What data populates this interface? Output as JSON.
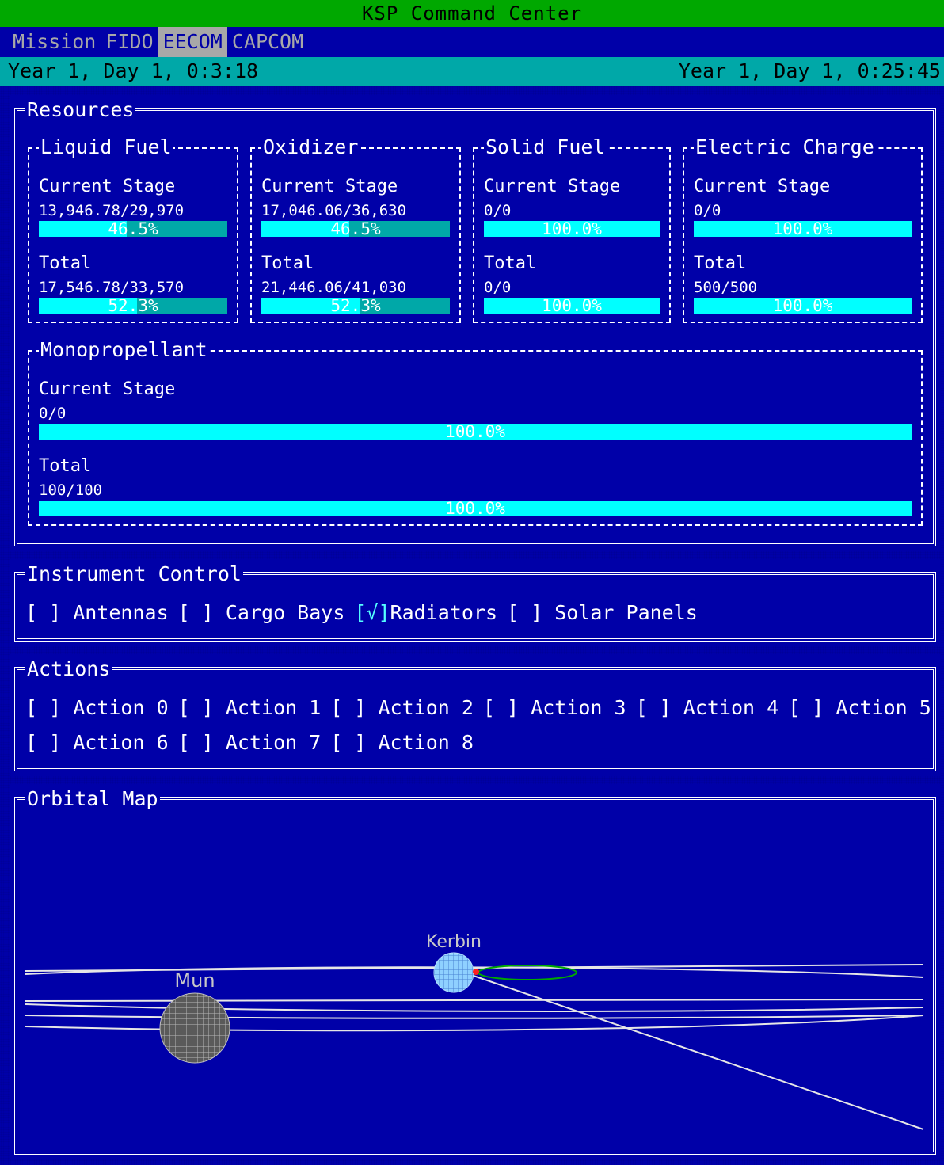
{
  "app": {
    "title": "KSP Command Center"
  },
  "menu": [
    {
      "label": "Mission",
      "active": false
    },
    {
      "label": "FIDO",
      "active": false
    },
    {
      "label": "EECOM",
      "active": true
    },
    {
      "label": "CAPCOM",
      "active": false
    }
  ],
  "status": {
    "left_time": "Year 1, Day 1, 0:3:18",
    "right_time": "Year 1, Day 1, 0:25:45"
  },
  "resources": {
    "title": "Resources",
    "current_label": "Current Stage",
    "total_label": "Total",
    "groups": [
      {
        "name": "Liquid Fuel",
        "current_value": "13,946.78/29,970",
        "current_pct_text": "46.5%",
        "current_pct": 46.5,
        "total_value": "17,546.78/33,570",
        "total_pct_text": "52.3%",
        "total_pct": 52.3
      },
      {
        "name": "Oxidizer",
        "current_value": "17,046.06/36,630",
        "current_pct_text": "46.5%",
        "current_pct": 46.5,
        "total_value": "21,446.06/41,030",
        "total_pct_text": "52.3%",
        "total_pct": 52.3
      },
      {
        "name": "Solid Fuel",
        "current_value": "0/0",
        "current_pct_text": "100.0%",
        "current_pct": 100,
        "total_value": "0/0",
        "total_pct_text": "100.0%",
        "total_pct": 100
      },
      {
        "name": "Electric Charge",
        "current_value": "0/0",
        "current_pct_text": "100.0%",
        "current_pct": 100,
        "total_value": "500/500",
        "total_pct_text": "100.0%",
        "total_pct": 100
      },
      {
        "name": "Monopropellant",
        "current_value": "0/0",
        "current_pct_text": "100.0%",
        "current_pct": 100,
        "total_value": "100/100",
        "total_pct_text": "100.0%",
        "total_pct": 100
      }
    ]
  },
  "instrument_control": {
    "title": "Instrument Control",
    "items": [
      {
        "label": "Antennas",
        "box": "[ ]",
        "checked": false
      },
      {
        "label": "Cargo Bays",
        "box": "[ ]",
        "checked": false
      },
      {
        "label": "Radiators",
        "box": "[√]",
        "checked": true
      },
      {
        "label": "Solar Panels",
        "box": "[ ]",
        "checked": false
      }
    ]
  },
  "actions": {
    "title": "Actions",
    "items": [
      {
        "label": "Action 0",
        "box": "[ ]"
      },
      {
        "label": "Action 1",
        "box": "[ ]"
      },
      {
        "label": "Action 2",
        "box": "[ ]"
      },
      {
        "label": "Action 3",
        "box": "[ ]"
      },
      {
        "label": "Action 4",
        "box": "[ ]"
      },
      {
        "label": "Action 5",
        "box": "[ ]"
      },
      {
        "label": "Action 6",
        "box": "[ ]"
      },
      {
        "label": "Action 7",
        "box": "[ ]"
      },
      {
        "label": "Action 8",
        "box": "[ ]"
      }
    ]
  },
  "orbital_map": {
    "title": "Orbital Map",
    "bodies": [
      {
        "name": "Kerbin"
      },
      {
        "name": "Mun"
      }
    ]
  },
  "colors": {
    "background": "#0000a8",
    "titlebar": "#00a800",
    "statusbar": "#00a8a8",
    "bar_empty": "#00a8a8",
    "bar_fill": "#00ffff",
    "menu_active": "#a8a8a8",
    "check": "#55ffff"
  }
}
